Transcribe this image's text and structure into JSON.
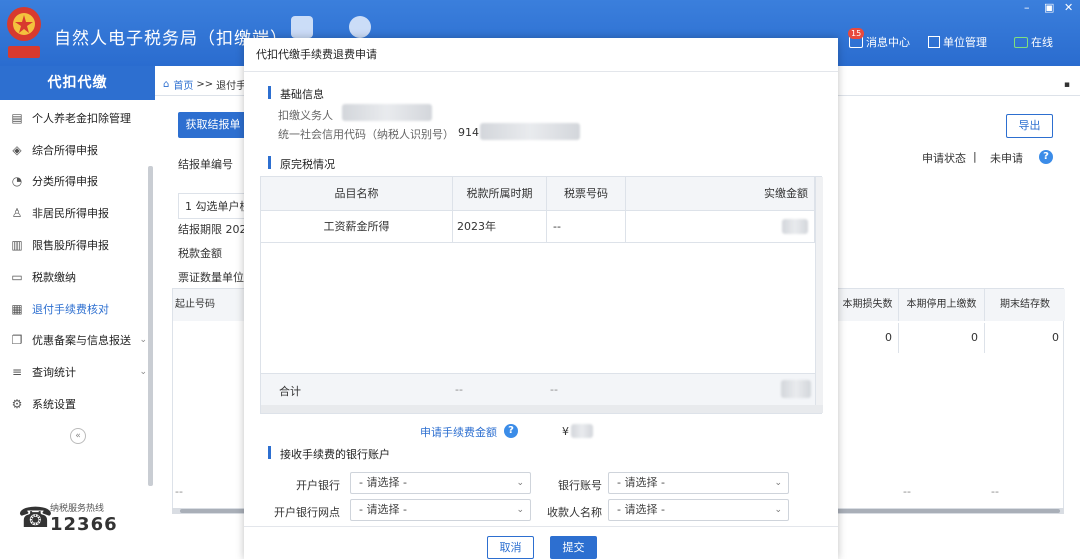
{
  "app": {
    "title": "自然人电子税务局（扣缴端）"
  },
  "window_controls": {
    "minimize": "–",
    "restore": "▣",
    "close": "✕"
  },
  "header": {
    "messages_badge": "15",
    "messages_label": "消息中心",
    "unit_label": "单位管理",
    "online_label": "在线"
  },
  "sidebar": {
    "title": "代扣代缴",
    "items": [
      {
        "label": "个人养老金扣除管理",
        "icon": "doc-icon"
      },
      {
        "label": "综合所得申报",
        "icon": "layers-icon"
      },
      {
        "label": "分类所得申报",
        "icon": "pie-icon"
      },
      {
        "label": "非居民所得申报",
        "icon": "person-icon"
      },
      {
        "label": "限售股所得申报",
        "icon": "bar-icon"
      },
      {
        "label": "税款缴纳",
        "icon": "folder-icon"
      },
      {
        "label": "退付手续费核对",
        "icon": "check-doc-icon"
      },
      {
        "label": "优惠备案与信息报送",
        "icon": "copy-icon"
      },
      {
        "label": "查询统计",
        "icon": "search-list-icon"
      },
      {
        "label": "系统设置",
        "icon": "gear-icon"
      }
    ],
    "collapse": "«",
    "hotline_label": "纳税服务热线",
    "hotline_number": "12366"
  },
  "main": {
    "breadcrumb_home": "首页",
    "breadcrumb_sep": ">>",
    "breadcrumb_current": "退付手",
    "get_report_button": "获取结报单",
    "export_button": "导出",
    "report_no_label": "结报单编号",
    "status_label": "申请状态",
    "status_sep": "|",
    "status_value": "未申请",
    "checked_label": "1 勾选单户核",
    "period_label": "结报期限  202",
    "tax_amount_label": "税款金额",
    "ticket_unit_label": "票证数量单位",
    "columns": [
      "起止号码",
      "本期损失数",
      "本期停用上缴数",
      "期末结存数"
    ],
    "row": [
      "0",
      "0",
      "0"
    ],
    "footer_dash_1": "--",
    "footer_dash_2": "--",
    "footer_dash_3": "--"
  },
  "modal": {
    "title": "代扣代缴手续费退费申请",
    "section_basic": "基础信息",
    "agent_label": "扣缴义务人",
    "credit_code_label": "统一社会信用代码（纳税人识别号）",
    "credit_code_prefix": "914",
    "section_tax": "原完税情况",
    "table_headers": [
      "品目名称",
      "税款所属时期",
      "税票号码",
      "实缴金额"
    ],
    "table_row": {
      "item": "工资薪金所得",
      "period": "2023年",
      "ticket": "--"
    },
    "total_label": "合计",
    "total_period": "--",
    "total_ticket": "--",
    "fee_label": "申请手续费金额",
    "fee_currency": "¥",
    "section_bank": "接收手续费的银行账户",
    "bank_label": "开户银行",
    "account_label": "银行账号",
    "branch_label": "开户银行网点",
    "payee_label": "收款人名称",
    "select_placeholder": "- 请选择 -",
    "cancel_button": "取消",
    "submit_button": "提交"
  }
}
